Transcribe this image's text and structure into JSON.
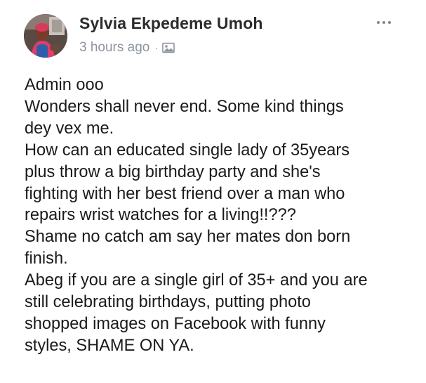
{
  "post": {
    "author": "Sylvia Ekpedeme Umoh",
    "timestamp": "3 hours ago",
    "separator": "·",
    "audience_icon": "photo-icon",
    "more_icon": "more-options-icon",
    "body_lines": [
      "Admin ooo",
      "Wonders shall never end.  Some kind things",
      "dey vex me.",
      "How can an educated single lady of 35years",
      "plus throw a big birthday party and she's",
      "fighting with her best friend over a man who",
      "repairs wrist watches for a living!!???",
      "Shame no catch am say her mates don born",
      "finish.",
      "Abeg if you are a single girl of 35+ and you are",
      "still celebrating birthdays, putting photo",
      "shopped images on Facebook with funny",
      "styles,  SHAME ON YA."
    ]
  },
  "colors": {
    "name": "#2b2b2b",
    "meta": "#8d949e",
    "body_text": "#1a1a1a",
    "background": "#ffffff"
  }
}
